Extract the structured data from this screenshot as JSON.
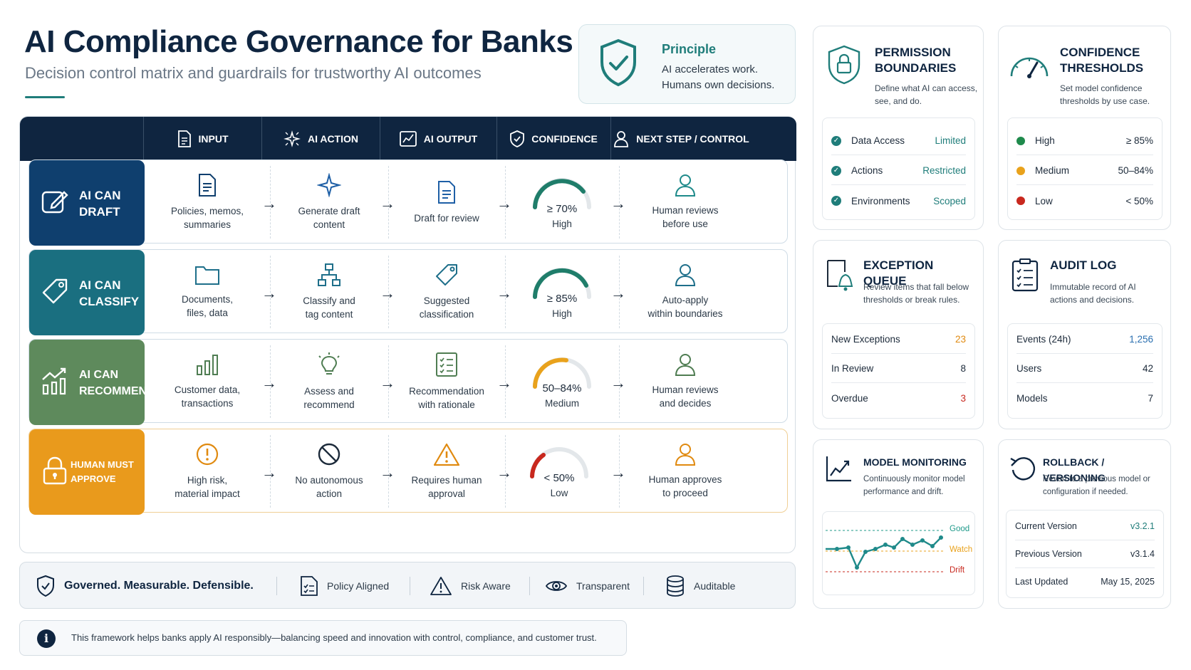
{
  "header": {
    "title": "AI Compliance Governance for Banks",
    "subtitle": "Decision control matrix and guardrails for trustworthy AI outcomes"
  },
  "principle": {
    "heading": "Principle",
    "text": "AI accelerates work. Humans own decisions."
  },
  "matrix": {
    "columns": [
      "INPUT",
      "AI ACTION",
      "AI OUTPUT",
      "CONFIDENCE",
      "NEXT STEP / CONTROL"
    ],
    "rows": [
      {
        "label": "AI CAN DRAFT",
        "color": "#0f3f6e",
        "input": "Policies, memos,\nsummaries",
        "action": "Generate draft\ncontent",
        "output": "Draft for review",
        "confidence": "≥ 70%",
        "level": "High",
        "next": "Human reviews\nbefore use"
      },
      {
        "label": "AI CAN CLASSIFY",
        "color": "#1a6f80",
        "input": "Documents,\nfiles, data",
        "action": "Classify and\ntag content",
        "output": "Suggested\nclassification",
        "confidence": "≥ 85%",
        "level": "High",
        "next": "Auto-apply\nwithin boundaries"
      },
      {
        "label": "AI CAN RECOMMEND",
        "color": "#5e8a5c",
        "input": "Customer data,\ntransactions",
        "action": "Assess and\nrecommend",
        "output": "Recommendation\nwith rationale",
        "confidence": "50–84%",
        "level": "Medium",
        "next": "Human reviews\nand decides"
      },
      {
        "label": "HUMAN MUST APPROVE",
        "color": "#e99a1c",
        "input": "High risk,\nmaterial impact",
        "action": "No autonomous\naction",
        "output": "Requires human\napproval",
        "confidence": "< 50%",
        "level": "Low",
        "next": "Human approves\nto proceed"
      }
    ]
  },
  "footer": {
    "tagline": "Governed. Measurable. Defensible.",
    "items": [
      "Policy Aligned",
      "Risk Aware",
      "Transparent",
      "Auditable"
    ]
  },
  "note": "This framework helps banks apply AI responsibly—balancing speed and innovation with control, compliance, and customer trust.",
  "permissions": {
    "title": "PERMISSION BOUNDARIES",
    "desc": "Define what AI can access, see, and do.",
    "rows": [
      {
        "label": "Data Access",
        "value": "Limited"
      },
      {
        "label": "Actions",
        "value": "Restricted"
      },
      {
        "label": "Environments",
        "value": "Scoped"
      }
    ]
  },
  "thresholds": {
    "title": "CONFIDENCE THRESHOLDS",
    "desc": "Set model confidence thresholds by use case.",
    "rows": [
      {
        "label": "High",
        "value": "≥ 85%",
        "color": "#1f8a4c"
      },
      {
        "label": "Medium",
        "value": "50–84%",
        "color": "#e9a21c"
      },
      {
        "label": "Low",
        "value": "< 50%",
        "color": "#c8281e"
      }
    ]
  },
  "exceptions": {
    "title": "EXCEPTION QUEUE",
    "desc": "Review items that fall below thresholds or break rules.",
    "rows": [
      {
        "label": "New Exceptions",
        "value": "23",
        "color": "#e08a10"
      },
      {
        "label": "In Review",
        "value": "8",
        "color": "#1c2a3a"
      },
      {
        "label": "Overdue",
        "value": "3",
        "color": "#c8281e"
      }
    ]
  },
  "audit": {
    "title": "AUDIT LOG",
    "desc": "Immutable record of AI actions and decisions.",
    "rows": [
      {
        "label": "Events (24h)",
        "value": "1,256",
        "color": "#2a6fb0"
      },
      {
        "label": "Users",
        "value": "42",
        "color": "#1c2a3a"
      },
      {
        "label": "Models",
        "value": "7",
        "color": "#1c2a3a"
      }
    ]
  },
  "monitoring": {
    "title": "MODEL MONITORING",
    "desc": "Continuously monitor model performance and drift.",
    "bands": [
      "Good",
      "Watch",
      "Drift"
    ],
    "band_colors": [
      "#1f9a8a",
      "#e9a21c",
      "#c8281e"
    ]
  },
  "rollback": {
    "title": "ROLLBACK / VERSIONING",
    "desc": "Revert to a previous model or configuration if needed.",
    "rows": [
      {
        "label": "Current Version",
        "value": "v3.2.1",
        "color": "#1f7d7a"
      },
      {
        "label": "Previous Version",
        "value": "v3.1.4",
        "color": "#1c2a3a"
      },
      {
        "label": "Last Updated",
        "value": "May 15, 2025",
        "color": "#1c2a3a"
      }
    ]
  }
}
